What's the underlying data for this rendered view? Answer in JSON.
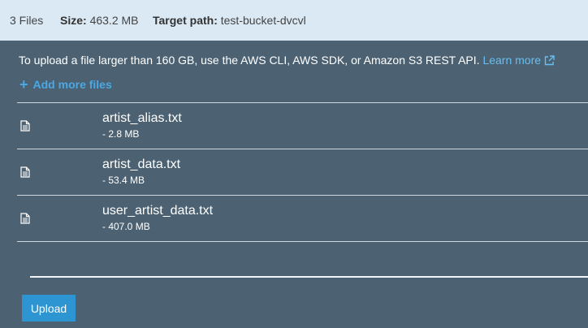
{
  "summary": {
    "files_count": "3 Files",
    "size_label": "Size:",
    "size_value": "463.2 MB",
    "target_label": "Target path:",
    "target_value": "test-bucket-dvcvl"
  },
  "info": {
    "text": "To upload a file larger than 160 GB, use the AWS CLI, AWS SDK, or Amazon S3 REST API.",
    "link": "Learn more",
    "link_icon": "external-link-icon"
  },
  "add_more": {
    "icon": "plus-icon",
    "label": "Add more files"
  },
  "files": [
    {
      "name": "artist_alias.txt",
      "size": "- 2.8 MB",
      "icon": "file-icon"
    },
    {
      "name": "artist_data.txt",
      "size": "- 53.4 MB",
      "icon": "file-icon"
    },
    {
      "name": "user_artist_data.txt",
      "size": "- 407.0 MB",
      "icon": "file-icon"
    }
  ],
  "upload_button": "Upload",
  "colors": {
    "background": "#4c6272",
    "topbar": "#dbe9f4",
    "accent": "#2e95d3",
    "link": "#67bff0"
  }
}
